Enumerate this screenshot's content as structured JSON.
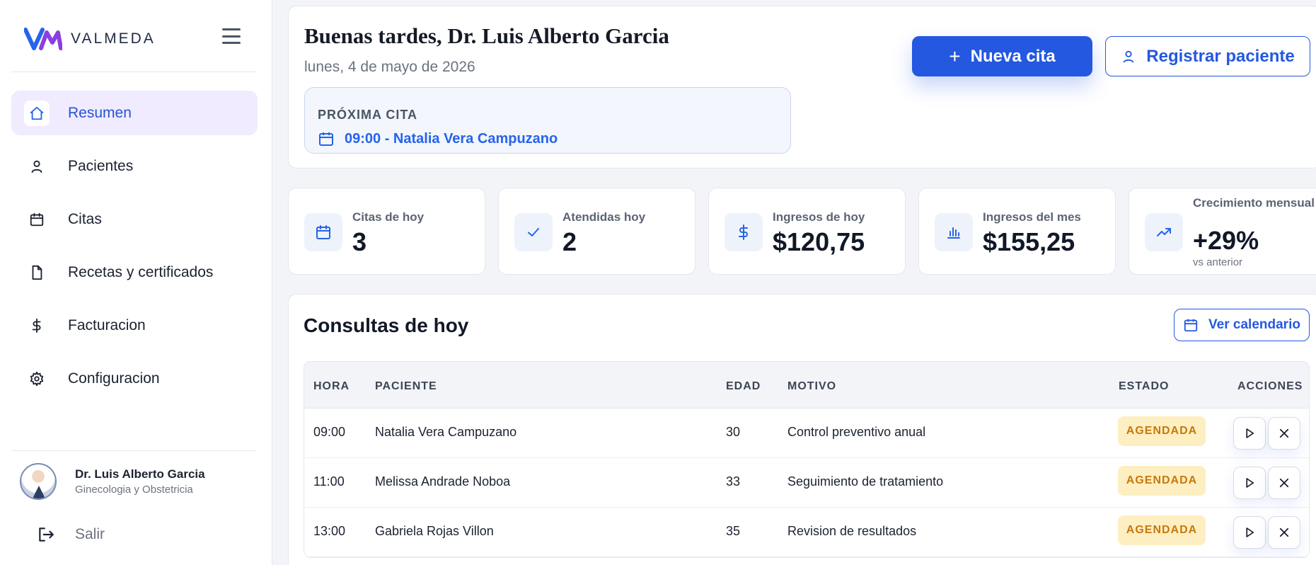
{
  "brand": {
    "name": "VALMEDA",
    "accent": "#2563eb",
    "accent_secondary": "#8b3fe0"
  },
  "sidebar": {
    "items": [
      {
        "label": "Resumen",
        "icon": "home-icon",
        "active": true
      },
      {
        "label": "Pacientes",
        "icon": "user-icon"
      },
      {
        "label": "Citas",
        "icon": "calendar-icon"
      },
      {
        "label": "Recetas y certificados",
        "icon": "file-icon"
      },
      {
        "label": "Facturacion",
        "icon": "dollar-icon"
      },
      {
        "label": "Configuracion",
        "icon": "gear-icon"
      }
    ],
    "profile": {
      "name": "Dr. Luis Alberto Garcia",
      "role": "Ginecologia y Obstetricia"
    },
    "logout_label": "Salir"
  },
  "header": {
    "greeting": "Buenas tardes, Dr. Luis Alberto Garcia",
    "date": "lunes, 4 de mayo de 2026",
    "next": {
      "title": "PRÓXIMA CITA",
      "text": "09:00 - Natalia Vera Campuzano"
    },
    "new_appointment_label": "Nueva cita",
    "register_patient_label": "Registrar paciente"
  },
  "stats": [
    {
      "label": "Citas de hoy",
      "value": "3",
      "icon": "calendar-icon"
    },
    {
      "label": "Atendidas hoy",
      "value": "2",
      "icon": "check-icon"
    },
    {
      "label": "Ingresos de hoy",
      "value": "$120,75",
      "icon": "dollar-icon"
    },
    {
      "label": "Ingresos del mes",
      "value": "$155,25",
      "icon": "bar-chart-icon"
    },
    {
      "label": "Crecimiento mensual",
      "value": "+29%",
      "sub": "vs anterior",
      "icon": "trending-up-icon"
    }
  ],
  "consultas": {
    "title": "Consultas de hoy",
    "calendar_label": "Ver calendario",
    "columns": {
      "hora": "HORA",
      "paciente": "PACIENTE",
      "edad": "EDAD",
      "motivo": "MOTIVO",
      "estado": "ESTADO",
      "acciones": "ACCIONES"
    },
    "rows": [
      {
        "hora": "09:00",
        "paciente": "Natalia Vera Campuzano",
        "edad": "30",
        "motivo": "Control preventivo anual",
        "estado": "AGENDADA"
      },
      {
        "hora": "11:00",
        "paciente": "Melissa Andrade Noboa",
        "edad": "33",
        "motivo": "Seguimiento de tratamiento",
        "estado": "AGENDADA"
      },
      {
        "hora": "13:00",
        "paciente": "Gabriela Rojas Villon",
        "edad": "35",
        "motivo": "Revision de resultados",
        "estado": "AGENDADA"
      }
    ]
  }
}
